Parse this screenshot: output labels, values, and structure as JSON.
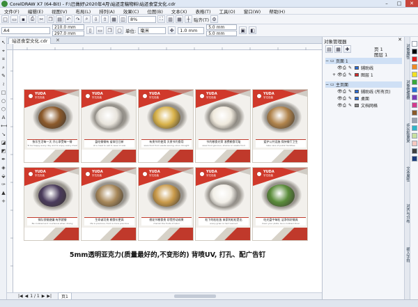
{
  "window": {
    "title": "CorelDRAW X7 (64-Bit) - F:\\已做好\\2020年4月\\站还定稿物料\\站还食堂文化.cdr",
    "min": "–",
    "max": "□",
    "close": "✕"
  },
  "menu": [
    "文件(F)",
    "编辑(E)",
    "视图(V)",
    "布局(L)",
    "排列(A)",
    "效果(C)",
    "位图(B)",
    "文本(X)",
    "表格(T)",
    "工具(O)",
    "窗口(W)",
    "帮助(H)"
  ],
  "toolbar": {
    "zoom": "8%",
    "snap_label": "贴齐(T)"
  },
  "property_bar": {
    "paper": "A4",
    "width": "210.0 mm",
    "height": "297.0 mm",
    "unit_label": "单位:",
    "unit": "毫米",
    "nudge": "1.0 mm",
    "dup_x": "5.0 mm",
    "dup_y": "5.0 mm"
  },
  "document_tab": "站还食堂文化.cdr",
  "posters": [
    {
      "cn": "快乐生活每一天 开心享受每一餐",
      "en": "To be happy every day and to enjoy every meal",
      "food": "#8c5a2b"
    },
    {
      "cn": "盈吃餐餐有 省穿日日新",
      "en": "at a meal to eat it, wear it new",
      "food": "#e8e4dc"
    },
    {
      "cn": "有贵节约使用 天贵节约食用",
      "en": "save food from waste saving, shun drought",
      "food": "#d8b24a"
    },
    {
      "cn": "节约粮食光荣 浪费粮食可耻",
      "en": "save food glorious, shame on waste food",
      "food": "#efe9dd"
    },
    {
      "cn": "爱护公共设施 保持餐厅卫生",
      "en": "take care of public facilities",
      "food": "#b0834b"
    },
    {
      "cn": "排队领餐避嫌 有序就餐",
      "en": "Be civilized and courteous when dining",
      "food": "#4a3b5c"
    },
    {
      "cn": "生命诚可贵 粮食价更高",
      "en": "life is precious, food is more precious",
      "food": "#a8885a"
    },
    {
      "cn": "桃花节粮食贵 珍惜劳动成果",
      "en": "cherish the fruits of labor",
      "food": "#c99a4a"
    },
    {
      "cn": "粒下的粒粒皆 来家的粒粒是出",
      "en": "every grain is hard earned",
      "food": "#f2efe8"
    },
    {
      "cn": "吃光盘中每粒 洁净你好餐具",
      "en": "clean your plate, be a civilized diner",
      "food": "#5a8c3a"
    }
  ],
  "brand": {
    "name": "YUDA",
    "sub": "宇达包装"
  },
  "bottom_note": "5mm透明亚克力(质量最好的,不变形的)  背喷UV, 打孔、配广告钉",
  "pager": {
    "first": "|◀",
    "prev": "◀",
    "current": "1 / 1",
    "next": "▶",
    "last": "▶|",
    "page_tab": "页1"
  },
  "docker": {
    "title": "对象管理器",
    "page": "页 1",
    "layer_top": "图层 1",
    "rows": [
      {
        "label": "页面 1",
        "expand": "−",
        "color": "",
        "highlight": true
      },
      {
        "label": "辅助线",
        "expand": "",
        "color": "#2b6cd4",
        "highlight": false
      },
      {
        "label": "图层 1",
        "expand": "+",
        "color": "#d32b2b",
        "highlight": false
      },
      {
        "label": "主页面",
        "expand": "−",
        "color": "",
        "highlight": true
      },
      {
        "label": "辅助线 (所有页)",
        "expand": "",
        "color": "#2b6cd4",
        "highlight": false
      },
      {
        "label": "桌面",
        "expand": "",
        "color": "#2b6cd4",
        "highlight": false
      },
      {
        "label": "文档网格",
        "expand": "",
        "color": "#888888",
        "highlight": false
      }
    ]
  },
  "side_tabs": [
    "对象属性",
    "对象管理器",
    "步长和重复",
    "文本属性",
    "对齐与分布",
    "插入字符"
  ],
  "palette": [
    "#ffffff",
    "#000000",
    "#e02020",
    "#f08a24",
    "#f2e024",
    "#3aa83a",
    "#2474d4",
    "#7a3ab8",
    "#d43a8c",
    "#8a5a2b",
    "#9aa3b0",
    "#2fb5c8",
    "#c8e0a0",
    "#f6c8c0",
    "#404040",
    "#1b3a7a"
  ]
}
